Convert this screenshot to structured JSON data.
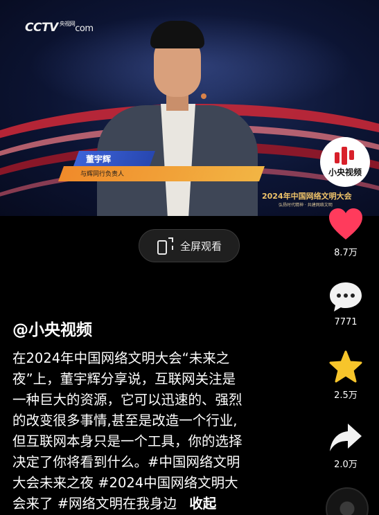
{
  "video": {
    "channel_logo": "CCTV",
    "channel_logo_sub": "央视网",
    "channel_logo_domain": "com",
    "lower_third_name": "董宇辉",
    "lower_third_title": "与辉同行负责人",
    "event_title": "2024年中国网络文明大会",
    "event_subtitle": "弘扬时代精神 · 共建网络文明"
  },
  "sidebar": {
    "brand_avatar_label": "小央视频",
    "like_count": "8.7万",
    "comment_count": "7771",
    "favorite_count": "2.5万",
    "share_count": "2.0万"
  },
  "fullscreen": {
    "label": "全屏观看"
  },
  "post": {
    "author": "@小央视频",
    "caption_lines": [
      "在2024年中国网络文明大会“未来之",
      "夜”上，董宇辉分享说，互联网关注是",
      "一种巨大的资源，它可以迅速的、强烈",
      "的改变很多事情,甚至是改造一个行业,",
      "但互联网本身只是一个工具，你的选择",
      "决定了你将看到什么。#中国网络文明",
      "大会未来之夜 #2024中国网络文明大",
      "会来了 #网络文明在我身边"
    ],
    "collapse_label": "收起"
  },
  "colors": {
    "like": "#ff3b5c",
    "favorite": "#f7c52b",
    "brand_red": "#d8202a",
    "lower_third_blue": "#3d63d8",
    "lower_third_orange": "#f08a2a"
  },
  "icons": [
    "heart-icon",
    "comment-icon",
    "star-icon",
    "share-icon",
    "fullscreen-icon",
    "music-disc-icon"
  ]
}
